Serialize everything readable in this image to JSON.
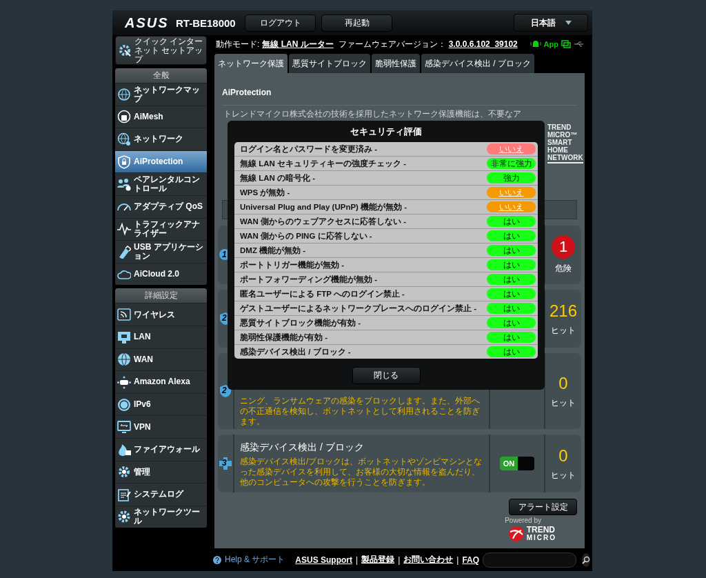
{
  "header": {
    "logo": "ASUS",
    "model": "RT-BE18000",
    "buttons": [
      "ログアウト",
      "再起動"
    ],
    "language": "日本語"
  },
  "status_line": {
    "mode_label": "動作モード:",
    "mode": "無線 LAN ルーター",
    "firmware_label": "ファームウェアバージョン：",
    "firmware": "3.0.0.6.102_39102",
    "app": "App"
  },
  "sidebar": {
    "quick_setup": "クイック インターネット セットアップ",
    "sections": [
      {
        "title": "全般",
        "items": [
          {
            "label": "ネットワークマップ",
            "selected": false
          },
          {
            "label": "AiMesh",
            "selected": false
          },
          {
            "label": "ネットワーク",
            "selected": false
          },
          {
            "label": "AiProtection",
            "selected": true
          },
          {
            "label": "ペアレンタルコントロール",
            "selected": false
          },
          {
            "label": "アダプティブ QoS",
            "selected": false
          },
          {
            "label": "トラフィックアナライザー",
            "selected": false
          },
          {
            "label": "USB アプリケーション",
            "selected": false
          },
          {
            "label": "AiCloud 2.0",
            "selected": false
          }
        ]
      },
      {
        "title": "詳細設定",
        "items": [
          {
            "label": "ワイヤレス",
            "selected": false
          },
          {
            "label": "LAN",
            "selected": false
          },
          {
            "label": "WAN",
            "selected": false
          },
          {
            "label": "Amazon Alexa",
            "selected": false
          },
          {
            "label": "IPv6",
            "selected": false
          },
          {
            "label": "VPN",
            "selected": false
          },
          {
            "label": "ファイアウォール",
            "selected": false
          },
          {
            "label": "管理",
            "selected": false
          },
          {
            "label": "システムログ",
            "selected": false
          },
          {
            "label": "ネットワークツール",
            "selected": false
          }
        ]
      }
    ]
  },
  "tabs": [
    {
      "label": "ネットワーク保護",
      "selected": true
    },
    {
      "label": "悪質サイトブロック",
      "selected": false
    },
    {
      "label": "脆弱性保護",
      "selected": false
    },
    {
      "label": "感染デバイス検出 / ブロック",
      "selected": false
    }
  ],
  "panel": {
    "title": "AiProtection",
    "intro": "トレンドマイクロ株式会社の技術を採用したネットワーク保護機能は、不要なア",
    "brand": "TREND MICRO™ SMART HOME NETWORK",
    "features": [
      {
        "kind": "risk",
        "number": "1",
        "count": "1",
        "count_label": "危険"
      },
      {
        "kind": "hits",
        "number": "2",
        "count": "216",
        "count_label": "ヒット"
      },
      {
        "kind": "hits",
        "number": "2",
        "description": "ニング、ランサムウェアの感染をブロックします。また、外部への不正通信を検知し、ボットネットとして利用されることを防ぎます。",
        "count": "0",
        "count_label": "ヒット"
      },
      {
        "kind": "hits",
        "number": "3",
        "title": "感染デバイス検出 / ブロック",
        "description": "感染デバイス検出/ブロックは、ボットネットやゾンビマシンとなった感染デバイスを利用して、お客様の大切な情報を盗んだり、他のコンピュータへの攻撃を行うことを防ぎます。",
        "toggle": {
          "label": "ON",
          "on": true
        },
        "count": "0",
        "count_label": "ヒット"
      }
    ],
    "alert_button": "アラート設定",
    "powered_by": "Powered by",
    "trend_logo": [
      "TREND",
      "MICRO"
    ]
  },
  "modal": {
    "title": "セキュリティ評価",
    "rows": [
      {
        "label": "ログイン名とパスワードを変更済み -",
        "status": "いいえ",
        "color": "#ff7b7b",
        "link": true
      },
      {
        "label": "無線 LAN セキュリティキーの強度チェック -",
        "status": "非常に強力",
        "color": "#18ff18",
        "link": false
      },
      {
        "label": "無線 LAN の暗号化 -",
        "status": "強力",
        "color": "#18ff18",
        "link": false
      },
      {
        "label": "WPS が無効 -",
        "status": "いいえ",
        "color": "#f29a00",
        "link": true
      },
      {
        "label": "Universal Plug and Play (UPnP) 機能が無効 -",
        "status": "いいえ",
        "color": "#f29a00",
        "link": true
      },
      {
        "label": "WAN 側からのウェブアクセスに応答しない -",
        "status": "はい",
        "color": "#18ff18",
        "link": false
      },
      {
        "label": "WAN 側からの PING に応答しない -",
        "status": "はい",
        "color": "#18ff18",
        "link": false
      },
      {
        "label": "DMZ 機能が無効 -",
        "status": "はい",
        "color": "#18ff18",
        "link": false
      },
      {
        "label": "ポートトリガー機能が無効 -",
        "status": "はい",
        "color": "#18ff18",
        "link": false
      },
      {
        "label": "ポートフォワーディング機能が無効 -",
        "status": "はい",
        "color": "#18ff18",
        "link": false
      },
      {
        "label": "匿名ユーザーによる FTP へのログイン禁止 -",
        "status": "はい",
        "color": "#18ff18",
        "link": false
      },
      {
        "label": "ゲストユーザーによるネットワークプレースへのログイン禁止 -",
        "status": "はい",
        "color": "#18ff18",
        "link": false
      },
      {
        "label": "悪質サイトブロック機能が有効 -",
        "status": "はい",
        "color": "#18ff18",
        "link": false
      },
      {
        "label": "脆弱性保護機能が有効 -",
        "status": "はい",
        "color": "#18ff18",
        "link": false
      },
      {
        "label": "感染デバイス検出 / ブロック -",
        "status": "はい",
        "color": "#18ff18",
        "link": false
      }
    ],
    "close": "閉じる"
  },
  "footer": {
    "help": "Help & サポート",
    "links": [
      "ASUS Support",
      "製品登録",
      "お問い合わせ",
      "FAQ"
    ],
    "separator": "|"
  }
}
